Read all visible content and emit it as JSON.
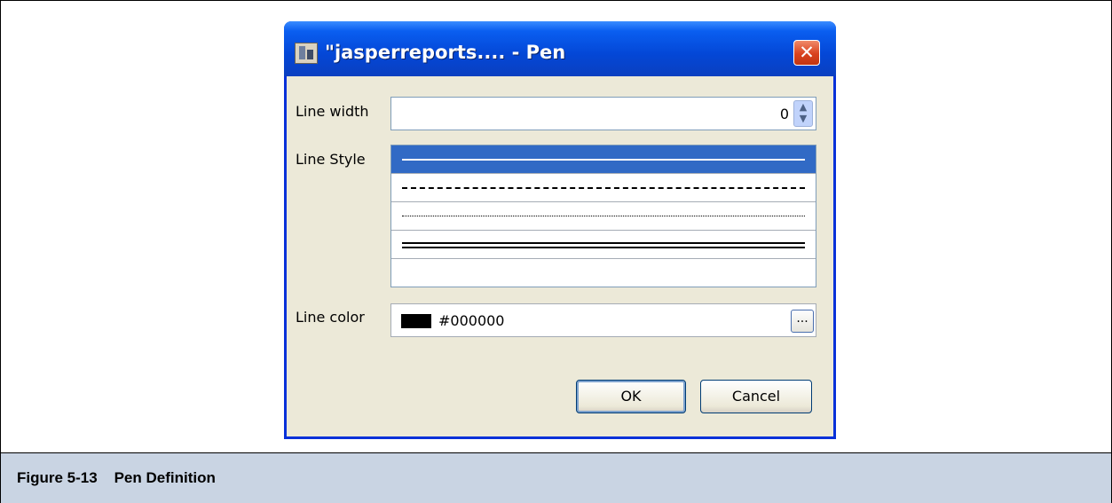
{
  "dialog": {
    "title": "\"jasperreports.... - Pen",
    "icon": "jasper-app-icon",
    "close_label": "✕"
  },
  "form": {
    "line_width_label": "Line width",
    "line_width_value": "0",
    "line_style_label": "Line Style",
    "line_styles": [
      "solid",
      "dashed",
      "dotted",
      "double",
      "none"
    ],
    "selected_line_style": "solid",
    "line_color_label": "Line color",
    "line_color_value": "#000000",
    "line_color_swatch": "#000000",
    "color_picker_label": "..."
  },
  "buttons": {
    "ok_label": "OK",
    "cancel_label": "Cancel"
  },
  "caption": {
    "text": "Figure 5-13    Pen Definition"
  },
  "colors": {
    "titlebar": "#0a5ef0",
    "client_bg": "#ece9d8",
    "selection": "#316ac5",
    "caption_bg": "#c9d4e3"
  }
}
